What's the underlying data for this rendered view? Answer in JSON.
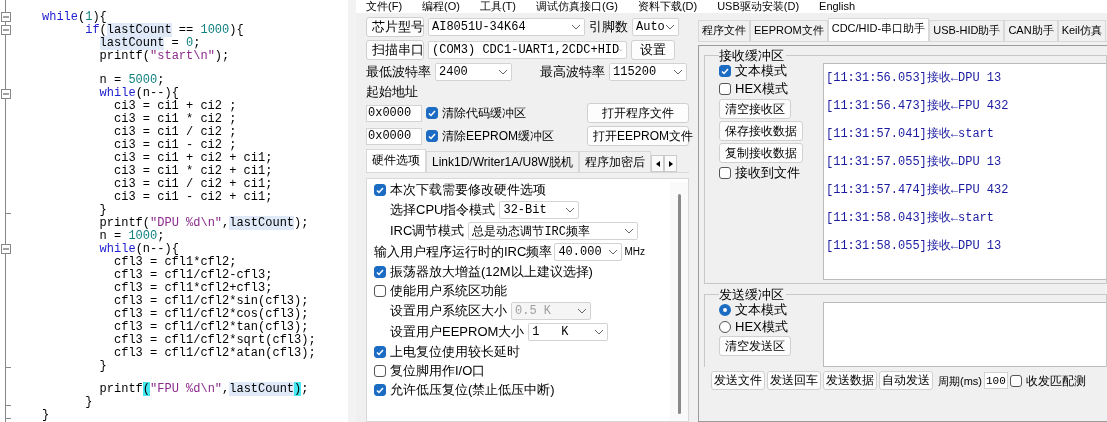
{
  "editor": {
    "lines": [
      {
        "kind": "block",
        "parts": [
          {
            "kind": "keyword",
            "text": "while"
          },
          {
            "kind": "plain",
            "text": "("
          },
          {
            "kind": "number",
            "text": "1"
          },
          {
            "kind": "plain",
            "text": "){"
          }
        ],
        "close": "}",
        "children": [
          {
            "kind": "block",
            "parts": [
              {
                "kind": "keyword",
                "text": "if"
              },
              {
                "kind": "plain",
                "text": "("
              },
              {
                "kind": "variable",
                "text": "lastCount"
              },
              {
                "kind": "plain",
                "text": " == "
              },
              {
                "kind": "number",
                "text": "1000"
              },
              {
                "kind": "plain",
                "text": "){"
              }
            ],
            "close": "}",
            "children": [
              {
                "kind": "code",
                "parts": [
                  {
                    "kind": "variable",
                    "text": "lastCount"
                  },
                  {
                    "kind": "plain",
                    "text": " = "
                  },
                  {
                    "kind": "number",
                    "text": "0"
                  },
                  {
                    "kind": "plain",
                    "text": ";"
                  }
                ]
              },
              {
                "kind": "code",
                "parts": [
                  {
                    "kind": "plain",
                    "text": "printf("
                  },
                  {
                    "kind": "string",
                    "text": "\"start\\n\""
                  },
                  {
                    "kind": "plain",
                    "text": ");"
                  }
                ]
              },
              {
                "kind": "blank"
              },
              {
                "kind": "code",
                "parts": [
                  {
                    "kind": "plain",
                    "text": "n = "
                  },
                  {
                    "kind": "number",
                    "text": "5000"
                  },
                  {
                    "kind": "plain",
                    "text": ";"
                  }
                ]
              },
              {
                "kind": "block",
                "parts": [
                  {
                    "kind": "keyword",
                    "text": "while"
                  },
                  {
                    "kind": "plain",
                    "text": "(n--){"
                  }
                ],
                "close": "}",
                "children": [
                  {
                    "kind": "code",
                    "parts": [
                      {
                        "kind": "plain",
                        "text": "ci3 = ci1 + ci2 ;"
                      }
                    ]
                  },
                  {
                    "kind": "code",
                    "parts": [
                      {
                        "kind": "plain",
                        "text": "ci3 = ci1 * ci2 ;"
                      }
                    ]
                  },
                  {
                    "kind": "code",
                    "parts": [
                      {
                        "kind": "plain",
                        "text": "ci3 = ci1 / ci2 ;"
                      }
                    ]
                  },
                  {
                    "kind": "code",
                    "parts": [
                      {
                        "kind": "plain",
                        "text": "ci3 = ci1 - ci2 ;"
                      }
                    ]
                  },
                  {
                    "kind": "code",
                    "parts": [
                      {
                        "kind": "plain",
                        "text": "ci3 = ci1 + ci2 + ci1;"
                      }
                    ]
                  },
                  {
                    "kind": "code",
                    "parts": [
                      {
                        "kind": "plain",
                        "text": "ci3 = ci1 * ci2 + ci1;"
                      }
                    ]
                  },
                  {
                    "kind": "code",
                    "parts": [
                      {
                        "kind": "plain",
                        "text": "ci3 = ci1 / ci2 + ci1;"
                      }
                    ]
                  },
                  {
                    "kind": "code",
                    "parts": [
                      {
                        "kind": "plain",
                        "text": "ci3 = ci1 - ci2 + ci1;"
                      }
                    ]
                  }
                ]
              },
              {
                "kind": "code",
                "parts": [
                  {
                    "kind": "plain",
                    "text": "printf("
                  },
                  {
                    "kind": "string",
                    "text": "\"DPU %d\\n\""
                  },
                  {
                    "kind": "plain",
                    "text": ","
                  },
                  {
                    "kind": "variable",
                    "text": "lastCount"
                  },
                  {
                    "kind": "plain",
                    "text": ");"
                  }
                ]
              },
              {
                "kind": "code",
                "parts": [
                  {
                    "kind": "plain",
                    "text": "n = "
                  },
                  {
                    "kind": "number",
                    "text": "1000"
                  },
                  {
                    "kind": "plain",
                    "text": ";"
                  }
                ]
              },
              {
                "kind": "block",
                "parts": [
                  {
                    "kind": "keyword",
                    "text": "while"
                  },
                  {
                    "kind": "plain",
                    "text": "(n--){"
                  }
                ],
                "close": "}",
                "children": [
                  {
                    "kind": "code",
                    "parts": [
                      {
                        "kind": "plain",
                        "text": "cfl3 = cfl1*cfl2;"
                      }
                    ]
                  },
                  {
                    "kind": "code",
                    "parts": [
                      {
                        "kind": "plain",
                        "text": "cfl3 = cfl1/cfl2-cfl3;"
                      }
                    ]
                  },
                  {
                    "kind": "code",
                    "parts": [
                      {
                        "kind": "plain",
                        "text": "cfl3 = cfl1*cfl2+cfl3;"
                      }
                    ]
                  },
                  {
                    "kind": "code",
                    "parts": [
                      {
                        "kind": "plain",
                        "text": "cfl3 = cfl1/cfl2*sin(cfl3);"
                      }
                    ]
                  },
                  {
                    "kind": "code",
                    "parts": [
                      {
                        "kind": "plain",
                        "text": "cfl3 = cfl1/cfl2*cos(cfl3);"
                      }
                    ]
                  },
                  {
                    "kind": "code",
                    "parts": [
                      {
                        "kind": "plain",
                        "text": "cfl3 = cfl1/cfl2*tan(cfl3);"
                      }
                    ]
                  },
                  {
                    "kind": "code",
                    "parts": [
                      {
                        "kind": "plain",
                        "text": "cfl3 = cfl1/cfl2*sqrt(cfl3);"
                      }
                    ]
                  },
                  {
                    "kind": "code",
                    "parts": [
                      {
                        "kind": "plain",
                        "text": "cfl3 = cfl1/cfl2*atan(cfl3);"
                      }
                    ]
                  }
                ]
              },
              {
                "kind": "blank"
              },
              {
                "kind": "code",
                "parts": [
                  {
                    "kind": "plain",
                    "text": "printf"
                  },
                  {
                    "kind": "match",
                    "text": "("
                  },
                  {
                    "kind": "string",
                    "text": "\"FPU %d\\n\""
                  },
                  {
                    "kind": "plain",
                    "text": ","
                  },
                  {
                    "kind": "variable",
                    "text": "lastCount"
                  },
                  {
                    "kind": "match",
                    "text": ")"
                  },
                  {
                    "kind": "plain",
                    "text": ";"
                  }
                ]
              }
            ]
          }
        ]
      }
    ]
  },
  "menu": [
    "文件(F)",
    "编程(O)",
    "工具(T)",
    "调试仿真接口(G)",
    "资料下载(D)",
    "USB驱动安装(D)",
    "English"
  ],
  "left_panel": {
    "chip_button": "芯片型号",
    "chip_select": "AI8051U-34K64",
    "pins_label": "引脚数",
    "pins_select": "Auto",
    "scan_button": "扫描串口",
    "port_select": "(COM3) CDC1-UART1,2CDC+HID",
    "settings_button": "设置",
    "min_baud_label": "最低波特率",
    "min_baud_select": "2400",
    "max_baud_label": "最高波特率",
    "max_baud_select": "115200",
    "start_address_label": "起始地址",
    "address_rows": [
      {
        "address": "0x0000",
        "checkbox": "清除代码缓冲区",
        "checked": true,
        "button": "打开程序文件"
      },
      {
        "address": "0x0000",
        "checkbox": "清除EEPROM缓冲区",
        "checked": true,
        "button": "打开EEPROM文件"
      }
    ],
    "tabs": [
      {
        "label": "硬件选项",
        "selected": true
      },
      {
        "label": "Link1D/Writer1A/U8W脱机",
        "selected": false
      },
      {
        "label": "程序加密后",
        "selected": false
      }
    ],
    "options": [
      {
        "kind": "checkbox",
        "label": "本次下载需要修改硬件选项",
        "checked": true
      },
      {
        "kind": "select",
        "label": "选择CPU指令模式",
        "value": "32-Bit",
        "disabled": false
      },
      {
        "kind": "select",
        "label": "IRC调节模式",
        "value": "总是动态调节IRC频率",
        "disabled": false
      },
      {
        "kind": "input",
        "label": "输入用户程序运行时的IRC频率",
        "value": "40.000",
        "unit": "MHz"
      },
      {
        "kind": "checkbox",
        "label": "振荡器放大增益(12M以上建议选择)",
        "checked": true
      },
      {
        "kind": "checkbox",
        "label": "使能用户系统区功能",
        "checked": false
      },
      {
        "kind": "select",
        "label": "设置用户系统区大小",
        "value": "0.5 K",
        "disabled": true
      },
      {
        "kind": "select",
        "label": "设置用户EEPROM大小",
        "value": "1   K",
        "disabled": false
      },
      {
        "kind": "checkbox",
        "label": "上电复位使用较长延时",
        "checked": true
      },
      {
        "kind": "checkbox",
        "label": "复位脚用作I/O口",
        "checked": false
      },
      {
        "kind": "checkbox",
        "label": "允许低压复位(禁止低压中断)",
        "checked": true
      }
    ]
  },
  "right_panel": {
    "tabs": [
      {
        "label": "程序文件",
        "selected": false
      },
      {
        "label": "EEPROM文件",
        "selected": false
      },
      {
        "label": "CDC/HID-串口助手",
        "selected": true
      },
      {
        "label": "USB-HID助手",
        "selected": false
      },
      {
        "label": "CAN助手",
        "selected": false
      },
      {
        "label": "Keil仿真",
        "selected": false
      }
    ],
    "receive": {
      "title": "接收缓冲区",
      "controls": [
        {
          "kind": "checkbox",
          "label": "文本模式",
          "checked": true
        },
        {
          "kind": "checkbox",
          "label": "HEX模式",
          "checked": false
        },
        {
          "kind": "button",
          "label": "清空接收区"
        },
        {
          "kind": "button",
          "label": "保存接收数据"
        },
        {
          "kind": "button",
          "label": "复制接收数据"
        },
        {
          "kind": "checkbox",
          "label": "接收到文件",
          "checked": false
        }
      ],
      "log": [
        "[11:31:56.053]接收←DPU 13",
        "[11:31:56.473]接收←FPU 432",
        "[11:31:57.041]接收←start",
        "[11:31:57.055]接收←DPU 13",
        "[11:31:57.474]接收←FPU 432",
        "[11:31:58.043]接收←start",
        "[11:31:58.055]接收←DPU 13"
      ]
    },
    "send": {
      "title": "发送缓冲区",
      "modes": [
        {
          "label": "文本模式",
          "selected": true
        },
        {
          "label": "HEX模式",
          "selected": false
        }
      ],
      "clear_button": "清空发送区"
    },
    "bottom": {
      "buttons": [
        "发送文件",
        "发送回车",
        "发送数据",
        "自动发送"
      ],
      "period_label": "周期(ms)",
      "period_value": "100",
      "match_test": {
        "label": "收发匹配测",
        "checked": false
      }
    }
  }
}
